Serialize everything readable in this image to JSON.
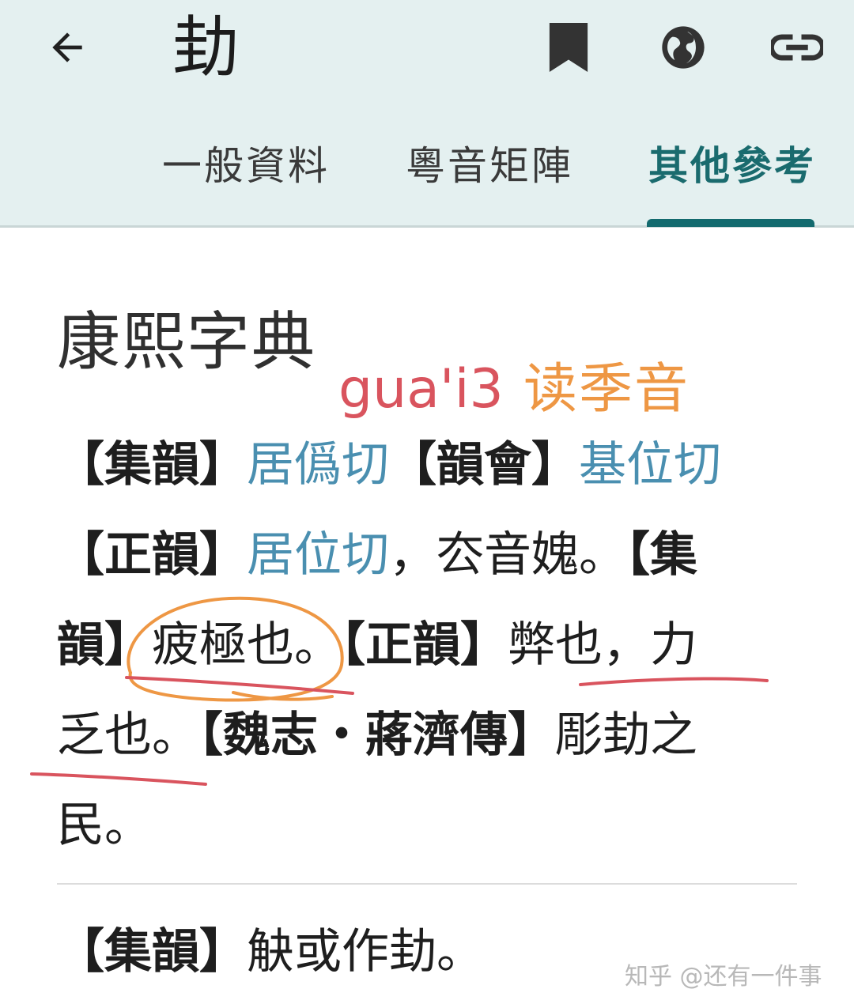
{
  "header": {
    "title": "劸",
    "icons": {
      "back": "arrow-back-icon",
      "bookmark": "bookmark-icon",
      "web": "globe-icon",
      "link": "link-icon"
    }
  },
  "tabs": [
    {
      "label": "一般資料",
      "active": false
    },
    {
      "label": "粵音矩陣",
      "active": false
    },
    {
      "label": "其他參考",
      "active": true
    }
  ],
  "section": {
    "title": "康熙字典"
  },
  "annotations": {
    "romanization": "gua'i3",
    "note": "读季音"
  },
  "entry": {
    "l1": {
      "a": "【集韻】",
      "b": "居僞切",
      "c": "【韻會】",
      "d": "基位切"
    },
    "l2": {
      "a": "【正韻】",
      "b": "居位切",
      "c": "，厺音媿。",
      "d": "【集"
    },
    "l3": {
      "a": "韻】",
      "b": "疲極也",
      "c": "。",
      "d": "【正韻】",
      "e": "弊也，力"
    },
    "l4": {
      "a": "乏也",
      "b": "。",
      "c": "【魏志・蔣濟傳】",
      "d": "彫劸之"
    },
    "l5": {
      "a": "民。"
    }
  },
  "second_entry": {
    "a": "【集韻】",
    "b": "觖或作劸。"
  },
  "watermark": "知乎 @还有一件事",
  "colors": {
    "appbar_bg": "#e4f0f0",
    "accent": "#136a6e",
    "link_blue": "#4a8fb0",
    "annot_red": "#d9545e",
    "annot_orange": "#ee9744"
  }
}
